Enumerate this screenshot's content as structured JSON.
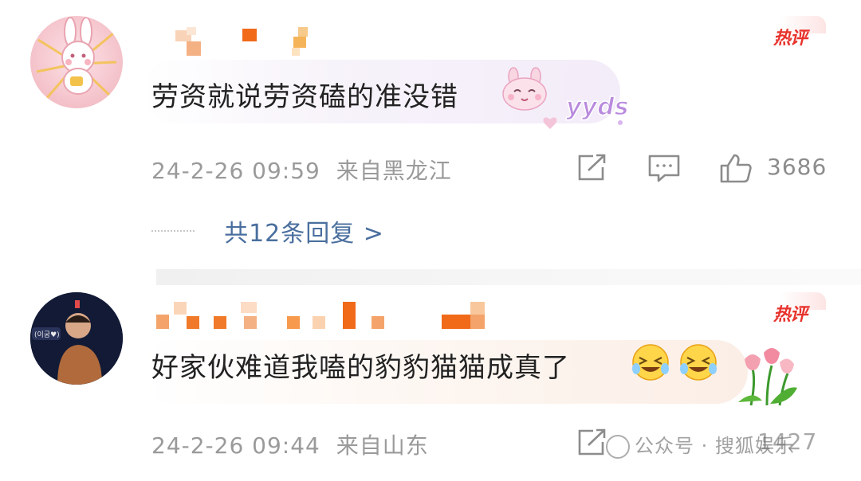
{
  "comments": [
    {
      "badge": "热评",
      "content": "劳资就说劳资磕的准没错",
      "sticker": "yyds",
      "time": "24-2-26 09:59",
      "location": "来自黑龙江",
      "like_count": "3686",
      "replies_label": "共12条回复 >"
    },
    {
      "badge": "热评",
      "content": "好家伙难道我嗑的豹豹猫猫成真了",
      "time": "24-2-26 09:44",
      "location": "来自山东",
      "like_count": "1427"
    }
  ],
  "avatar_caption": "(이궁♥)",
  "watermark": "公众号 · 搜狐娱乐",
  "icons": [
    "share-icon",
    "comment-icon",
    "like-icon",
    "bunny-sticker-icon",
    "laughing-emoji-icon",
    "tulip-sticker-icon",
    "bunny-avatar-icon"
  ],
  "colors": {
    "hot_badge": "#e8322c",
    "meta_text": "#9a9a9a",
    "reply_link": "#4a6f9e",
    "mosaic_orange": "#f08a2e"
  }
}
